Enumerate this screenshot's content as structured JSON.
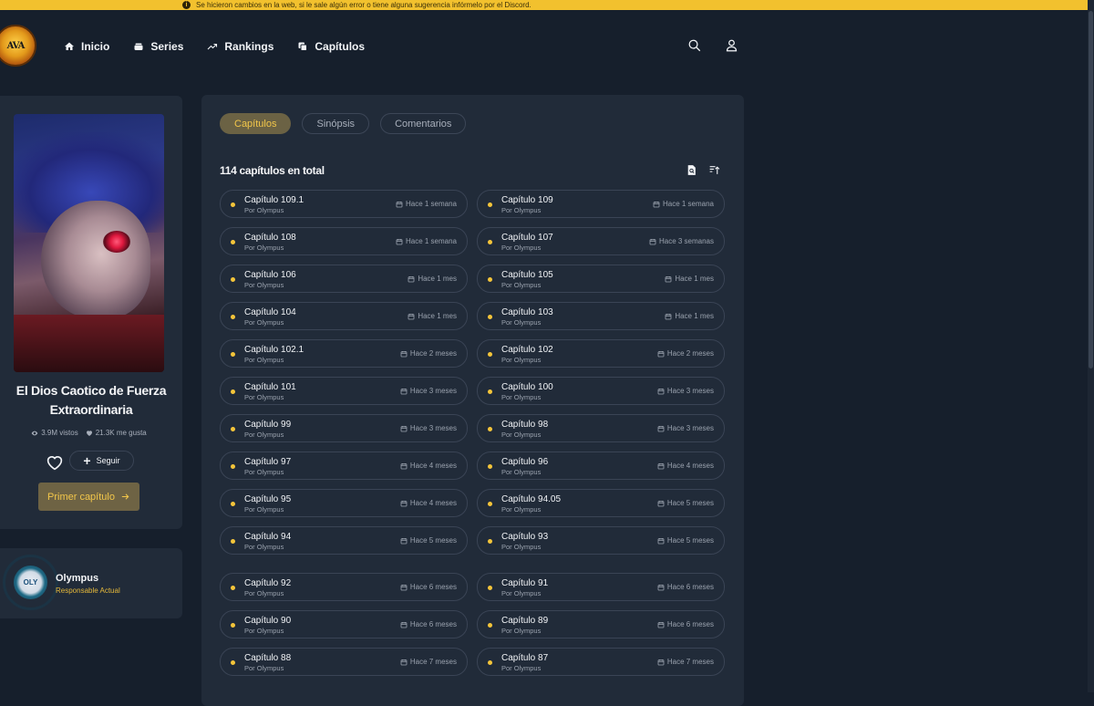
{
  "banner": {
    "text": "Se hicieron cambios en la web, si le sale algún error o tiene alguna sugerencia infórmelo por el Discord."
  },
  "nav": {
    "logo_text": "AVA",
    "items": [
      {
        "label": "Inicio",
        "icon": "home-icon"
      },
      {
        "label": "Series",
        "icon": "stack-icon"
      },
      {
        "label": "Rankings",
        "icon": "trending-icon"
      },
      {
        "label": "Capítulos",
        "icon": "copy-icon"
      }
    ]
  },
  "series": {
    "title": "El Dios Caotico de Fuerza Extraordinaria",
    "views": "3.9M vistos",
    "likes": "21.3K me gusta",
    "follow_label": "Seguir",
    "first_chapter_label": "Primer capítulo"
  },
  "owner": {
    "name": "Olympus",
    "role": "Responsable Actual",
    "avatar_text": "OLY"
  },
  "tabs": [
    {
      "label": "Capítulos",
      "active": true
    },
    {
      "label": "Sinópsis",
      "active": false
    },
    {
      "label": "Comentarios",
      "active": false
    }
  ],
  "chapters_total": "114 capítulos en total",
  "chapters": [
    {
      "name": "Capítulo 109.1",
      "by": "Por Olympus",
      "when": "Hace 1 semana"
    },
    {
      "name": "Capítulo 109",
      "by": "Por Olympus",
      "when": "Hace 1 semana"
    },
    {
      "name": "Capítulo 108",
      "by": "Por Olympus",
      "when": "Hace 1 semana"
    },
    {
      "name": "Capítulo 107",
      "by": "Por Olympus",
      "when": "Hace 3 semanas"
    },
    {
      "name": "Capítulo 106",
      "by": "Por Olympus",
      "when": "Hace 1 mes"
    },
    {
      "name": "Capítulo 105",
      "by": "Por Olympus",
      "when": "Hace 1 mes"
    },
    {
      "name": "Capítulo 104",
      "by": "Por Olympus",
      "when": "Hace 1 mes"
    },
    {
      "name": "Capítulo 103",
      "by": "Por Olympus",
      "when": "Hace 1 mes"
    },
    {
      "name": "Capítulo 102.1",
      "by": "Por Olympus",
      "when": "Hace 2 meses"
    },
    {
      "name": "Capítulo 102",
      "by": "Por Olympus",
      "when": "Hace 2 meses"
    },
    {
      "name": "Capítulo 101",
      "by": "Por Olympus",
      "when": "Hace 3 meses"
    },
    {
      "name": "Capítulo 100",
      "by": "Por Olympus",
      "when": "Hace 3 meses"
    },
    {
      "name": "Capítulo 99",
      "by": "Por Olympus",
      "when": "Hace 3 meses"
    },
    {
      "name": "Capítulo 98",
      "by": "Por Olympus",
      "when": "Hace 3 meses"
    },
    {
      "name": "Capítulo 97",
      "by": "Por Olympus",
      "when": "Hace 4 meses"
    },
    {
      "name": "Capítulo 96",
      "by": "Por Olympus",
      "when": "Hace 4 meses"
    },
    {
      "name": "Capítulo 95",
      "by": "Por Olympus",
      "when": "Hace 4 meses"
    },
    {
      "name": "Capítulo 94.05",
      "by": "Por Olympus",
      "when": "Hace 5 meses"
    },
    {
      "name": "Capítulo 94",
      "by": "Por Olympus",
      "when": "Hace 5 meses"
    },
    {
      "name": "Capítulo 93",
      "by": "Por Olympus",
      "when": "Hace 5 meses"
    },
    {
      "name": "Capítulo 92",
      "by": "Por Olympus",
      "when": "Hace 6 meses"
    },
    {
      "name": "Capítulo 91",
      "by": "Por Olympus",
      "when": "Hace 6 meses"
    },
    {
      "name": "Capítulo 90",
      "by": "Por Olympus",
      "when": "Hace 6 meses"
    },
    {
      "name": "Capítulo 89",
      "by": "Por Olympus",
      "when": "Hace 6 meses"
    },
    {
      "name": "Capítulo 88",
      "by": "Por Olympus",
      "when": "Hace 7 meses"
    },
    {
      "name": "Capítulo 87",
      "by": "Por Olympus",
      "when": "Hace 7 meses"
    }
  ],
  "colors": {
    "accent": "#f5c53a",
    "banner": "#f2c12e",
    "card": "#212b39",
    "background": "#161f2c"
  }
}
